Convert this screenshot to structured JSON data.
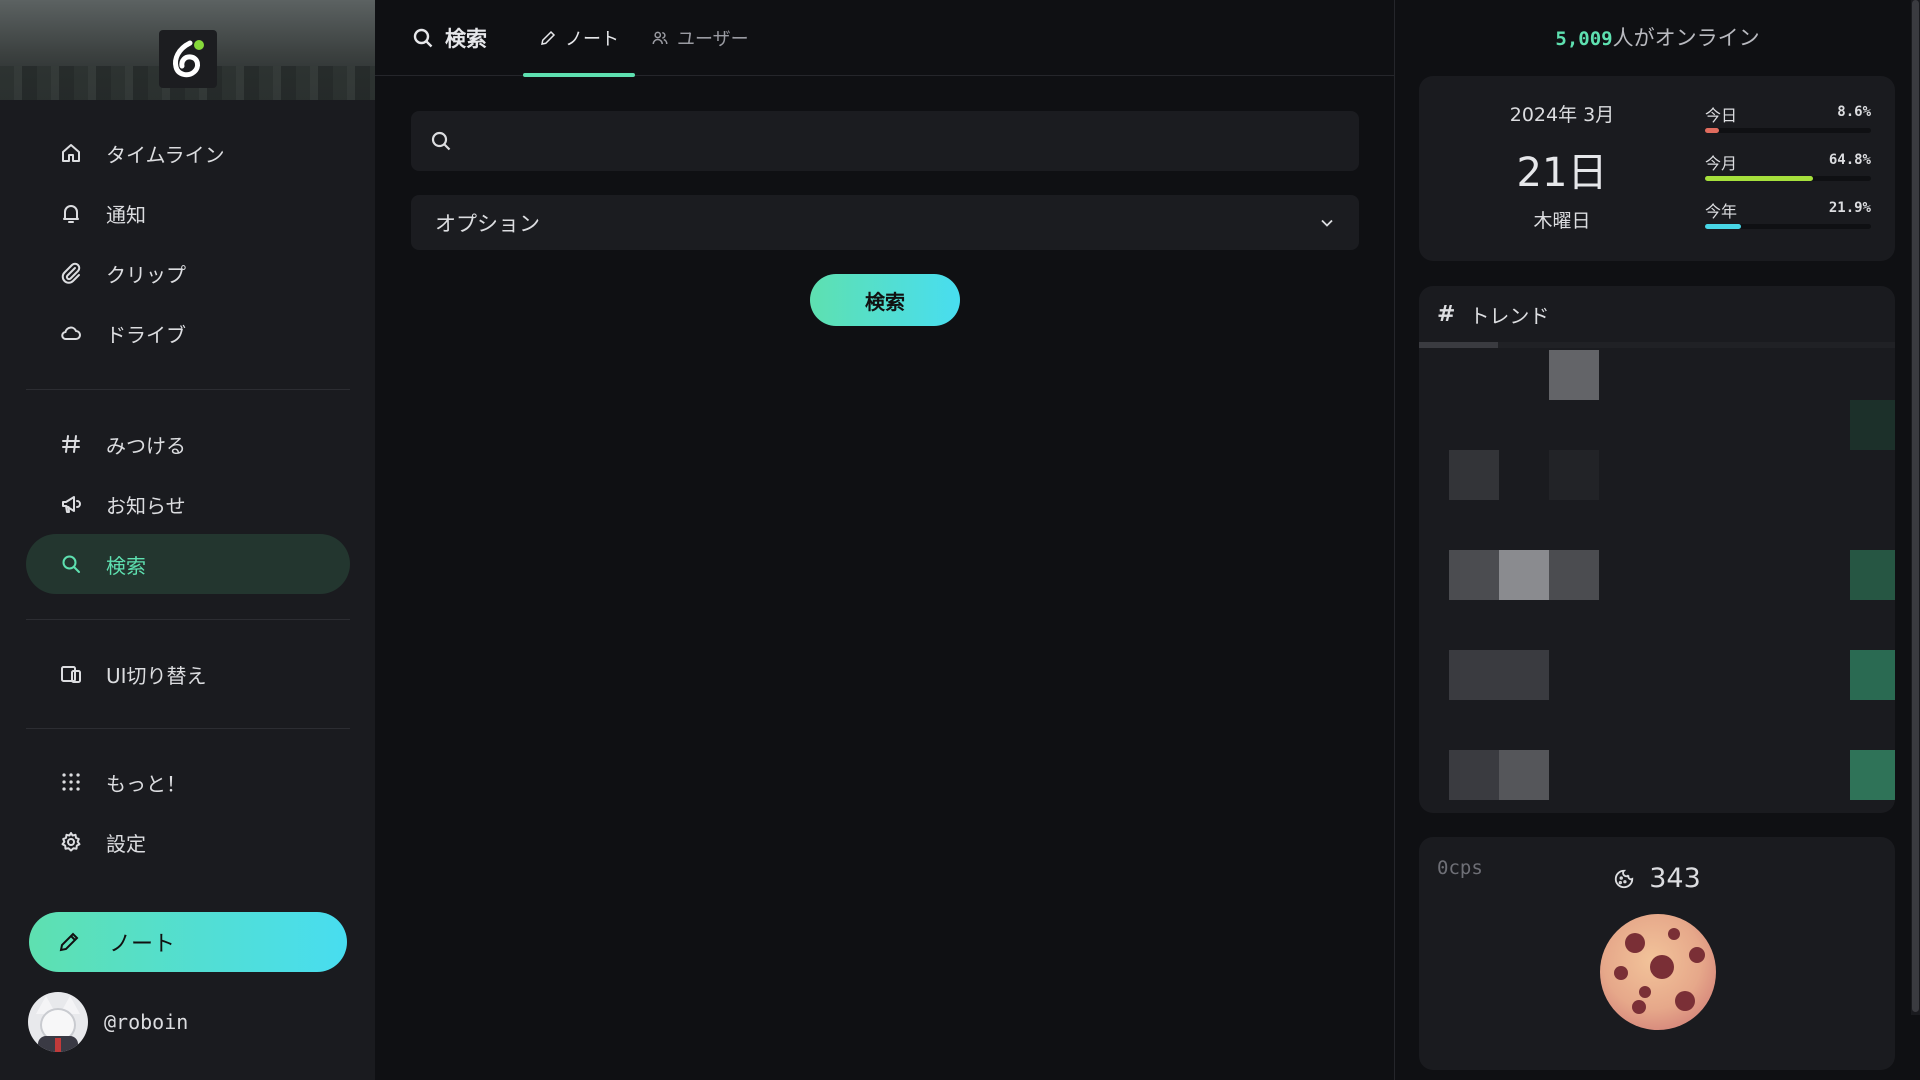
{
  "sidebar": {
    "nav1": [
      {
        "label": "タイムライン",
        "icon": "home-icon"
      },
      {
        "label": "通知",
        "icon": "bell-icon"
      },
      {
        "label": "クリップ",
        "icon": "paperclip-icon"
      },
      {
        "label": "ドライブ",
        "icon": "cloud-icon"
      }
    ],
    "nav2": [
      {
        "label": "みつける",
        "icon": "hash-icon"
      },
      {
        "label": "お知らせ",
        "icon": "megaphone-icon"
      },
      {
        "label": "検索",
        "icon": "search-icon",
        "active": true
      }
    ],
    "nav3": [
      {
        "label": "UI切り替え",
        "icon": "devices-icon"
      }
    ],
    "nav4": [
      {
        "label": "もっと！",
        "icon": "grid-dots-icon"
      },
      {
        "label": "設定",
        "icon": "gear-icon"
      }
    ],
    "note_button": "ノート",
    "account": "@roboin"
  },
  "main": {
    "title": "検索",
    "tabs": [
      {
        "label": "ノート",
        "icon": "pencil-icon",
        "active": true
      },
      {
        "label": "ユーザー",
        "icon": "users-icon",
        "active": false
      }
    ],
    "search_value": "",
    "options_label": "オプション",
    "search_button": "検索"
  },
  "right": {
    "online_count": "5,009",
    "online_suffix": "人がオンライン",
    "calendar": {
      "year_month": "2024年 3月",
      "day": "21日",
      "weekday": "木曜日",
      "stats": [
        {
          "label": "今日",
          "percent": "8.6%",
          "value": 0.086,
          "color": "#e06c5e"
        },
        {
          "label": "今月",
          "percent": "64.8%",
          "value": 0.648,
          "color": "#a6e03c"
        },
        {
          "label": "今年",
          "percent": "21.9%",
          "value": 0.219,
          "color": "#48d6e6"
        }
      ]
    },
    "trend_title": "トレンド",
    "cookie": {
      "cps": "0cps",
      "count": "343"
    }
  },
  "colors": {
    "accent": "#5ee0b0",
    "accent2": "#48ddf0",
    "bg": "#0f1013",
    "panel": "#1a1b1f"
  }
}
